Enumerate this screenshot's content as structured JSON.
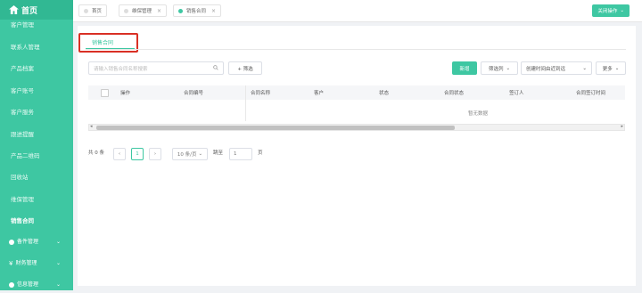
{
  "sidebar": {
    "logo_text": "首页",
    "items": [
      {
        "label": "客户管理"
      },
      {
        "label": "联系人管理"
      },
      {
        "label": "产品档案"
      },
      {
        "label": "客户账号"
      },
      {
        "label": "客户服务"
      },
      {
        "label": "跟进提醒"
      },
      {
        "label": "产品二维码"
      },
      {
        "label": "回收站"
      },
      {
        "label": "维保管理"
      },
      {
        "label": "销售合同"
      }
    ],
    "groups": [
      {
        "label": "备件管理"
      },
      {
        "label": "财务管理"
      },
      {
        "label": "信息管理"
      }
    ]
  },
  "topbar": {
    "tabs": [
      {
        "label": "首页"
      },
      {
        "label": "维保管理"
      },
      {
        "label": "销售合同"
      }
    ],
    "close_ops_label": "关闭操作"
  },
  "subtab": {
    "label": "销售合同"
  },
  "toolbar": {
    "search_placeholder": "请输入销售合同名称搜索",
    "filter_label": "+ 筛选",
    "new_label": "新增",
    "columns_label": "筛选列",
    "sort_label": "创建时间由近到远",
    "more_label": "更多"
  },
  "table": {
    "headers": [
      "操作",
      "合同编号",
      "合同名称",
      "客户",
      "状态",
      "合同状态",
      "签订人",
      "合同签订时间"
    ],
    "empty_text": "暂无数据"
  },
  "pagination": {
    "total": "共 0 条",
    "current_page": "1",
    "page_size": "10 条/页",
    "goto_label": "跳至",
    "goto_value": "1",
    "page_suffix": "页"
  },
  "colors": {
    "accent": "#3ec7a2",
    "highlight": "#d93025"
  }
}
